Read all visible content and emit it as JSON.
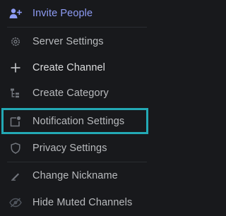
{
  "menu": {
    "items": [
      {
        "label": "Invite People",
        "icon": "invite-people-icon"
      },
      {
        "label": "Server Settings",
        "icon": "gear-icon"
      },
      {
        "label": "Create Channel",
        "icon": "plus-icon"
      },
      {
        "label": "Create Category",
        "icon": "create-category-icon"
      },
      {
        "label": "Notification Settings",
        "icon": "notification-bell-icon"
      },
      {
        "label": "Privacy Settings",
        "icon": "shield-icon"
      },
      {
        "label": "Change Nickname",
        "icon": "pencil-icon"
      },
      {
        "label": "Hide Muted Channels",
        "icon": "eye-slash-icon"
      }
    ]
  },
  "colors": {
    "background": "#18191c",
    "accent": "#8e9cf5",
    "highlight_border": "#23a9b5",
    "text": "#b9bbbe"
  }
}
